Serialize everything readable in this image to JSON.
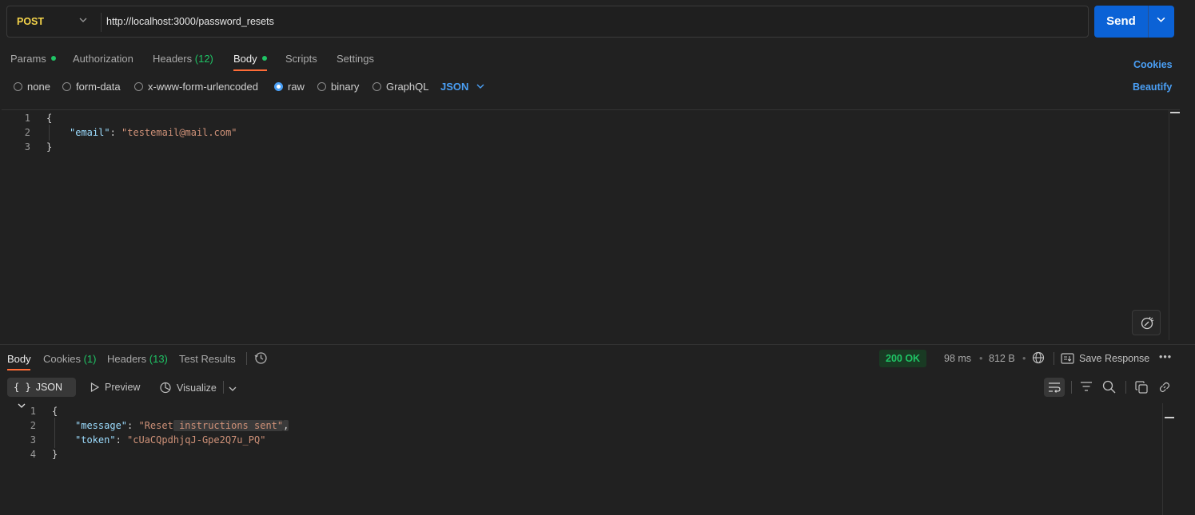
{
  "request": {
    "method": "POST",
    "url": "http://localhost:3000/password_resets",
    "send_label": "Send"
  },
  "tabs": {
    "params": "Params",
    "authorization": "Authorization",
    "headers": "Headers",
    "headers_count": "(12)",
    "body": "Body",
    "scripts": "Scripts",
    "settings": "Settings",
    "active": "Body"
  },
  "links": {
    "cookies": "Cookies",
    "beautify": "Beautify"
  },
  "body_types": {
    "none": "none",
    "form_data": "form-data",
    "urlencoded": "x-www-form-urlencoded",
    "raw": "raw",
    "binary": "binary",
    "graphql": "GraphQL",
    "selected": "raw",
    "format": "JSON"
  },
  "request_body": {
    "line_numbers": [
      "1",
      "2",
      "3"
    ],
    "open": "{",
    "key": "\"email\"",
    "colon": ": ",
    "value": "\"testemail@mail.com\"",
    "close": "}"
  },
  "response_tabs": {
    "body": "Body",
    "cookies": "Cookies",
    "cookies_count": "(1)",
    "headers": "Headers",
    "headers_count": "(13)",
    "test_results": "Test Results",
    "active": "Body"
  },
  "response_meta": {
    "status": "200 OK",
    "time": "98 ms",
    "size": "812 B",
    "save_response": "Save Response",
    "status_color": "#1fc465"
  },
  "response_toolbar": {
    "format": "JSON",
    "preview": "Preview",
    "visualize": "Visualize"
  },
  "response_body": {
    "line_numbers": [
      "1",
      "2",
      "3",
      "4"
    ],
    "open": "{",
    "message_key": "\"message\"",
    "message_value_a": "\"Reset",
    "message_value_b": " instructions sent\"",
    "comma": ",",
    "token_key": "\"token\"",
    "token_value": "\"cUaCQpdhjqJ-Gpe2Q7u_PQ\"",
    "close": "}"
  },
  "colors": {
    "accent": "#0b62d6",
    "method": "#f5d44a",
    "tab_indicator": "#ff6c37",
    "link": "#4a9ff5",
    "dot_green": "#1fc465"
  }
}
